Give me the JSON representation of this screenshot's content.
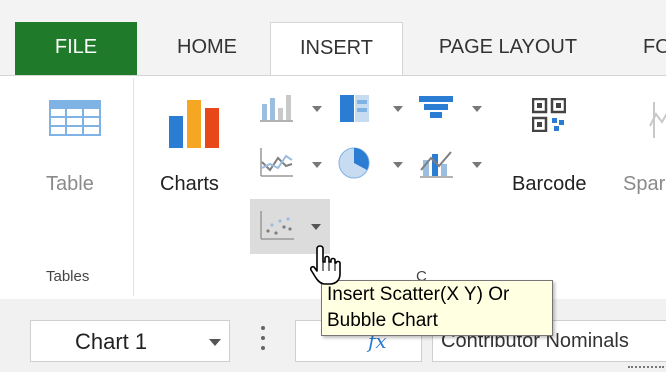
{
  "tabs": {
    "file": "FILE",
    "home": "HOME",
    "insert": "INSERT",
    "page_layout": "PAGE LAYOUT",
    "partial": "FO"
  },
  "ribbon": {
    "table_label": "Table",
    "charts_label": "Charts",
    "barcode_label": "Barcode",
    "sparklines_partial": "Spar",
    "group_tables": "Tables"
  },
  "tooltip": {
    "line1": "Insert Scatter(X Y) Or",
    "line2": "Bubble Chart"
  },
  "formula_bar": {
    "name_box_value": "Chart 1",
    "formula_value": "Contributor Nominals"
  },
  "colors": {
    "file_tab": "#1f7a2a",
    "tooltip_bg": "#ffffe1",
    "chart_blue": "#2b7cd3",
    "chart_orange": "#f5a623"
  },
  "icons": [
    "table-icon",
    "charts-icon",
    "column-chart-icon",
    "stacked-bar-icon",
    "funnel-chart-icon",
    "line-chart-icon",
    "pie-chart-icon",
    "combo-chart-icon",
    "scatter-chart-icon",
    "barcode-icon",
    "hand-pointer-icon",
    "fx-icon"
  ]
}
